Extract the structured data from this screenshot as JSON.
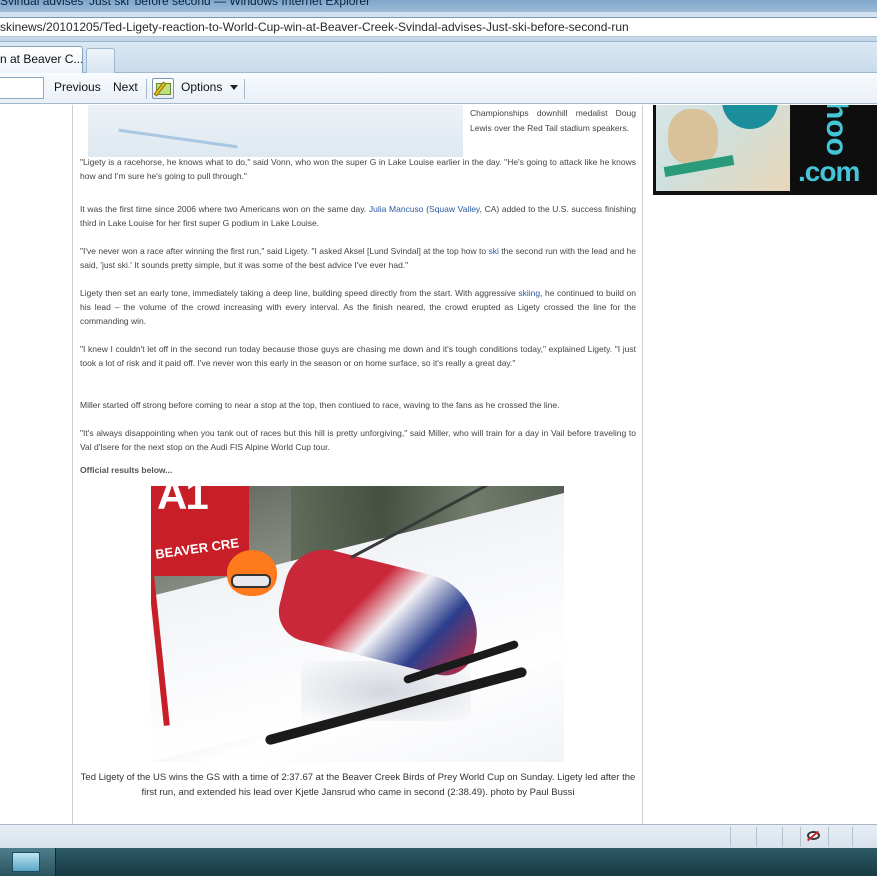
{
  "window": {
    "title": "Svindal advises 'Just ski' before second — Windows Internet Explorer"
  },
  "address": {
    "url": "skinews/20101205/Ted-Ligety-reaction-to-World-Cup-win-at-Beaver-Creek-Svindal-advises-Just-ski-before-second-run"
  },
  "tabs": [
    {
      "label": "n at Beaver C..."
    }
  ],
  "findbar": {
    "search_value": "",
    "previous_label": "Previous",
    "next_label": "Next",
    "options_label": "Options"
  },
  "article": {
    "top_caption": "Championships downhill medalist Doug Lewis over the Red Tail stadium speakers.",
    "p1": "\"Ligety is a racehorse, he knows what to do,\" said Vonn, who won the super G in Lake Louise earlier in the day. \"He's going to attack like he knows how and I'm sure he's going to pull through.\"",
    "p2_a": "It was the first time since 2006 where two Americans won on the same day. ",
    "p2_link1": "Julia Mancuso",
    "p2_b": " (",
    "p2_link2": "Squaw Valley",
    "p2_c": ", CA) added to the U.S. success finishing third in Lake Louise for her first super G podium in Lake Louise.",
    "p3_a": "\"I've never won a race after winning the first run,\" said Ligety. \"I asked Aksel [Lund Svindal] at the top how to ",
    "p3_link": "ski",
    "p3_b": " the second run with the lead and he said, 'just ski.' It sounds pretty simple, but it was some of the best advice I've ever had.\"",
    "p4_a": "Ligety then set an early tone, immediately taking a deep line, building speed directly from the start. With aggressive ",
    "p4_link": "skiing",
    "p4_b": ", he continued to build on his lead – the volume of the crowd increasing with every interval. As the finish neared, the crowd erupted as Ligety crossed the line for the commanding win.",
    "p5": "\"I knew I couldn't let off in the second run today because those guys are chasing me down and it's tough conditions today,\" explained Ligety. \"I just took a lot of risk and it paid off. I've never won this early in the season or on home surface, so it's really a great day.\"",
    "p6": "Miller started off strong before coming to near a stop at the top, then contiued to race, waving to the fans as he crossed the line.",
    "p7": "\"It's always disappointing when you tank out of races but this hill is pretty unforgiving,\" said Miller, who will train for a day in Vail before traveling to Val d'Isere for the next stop on the Audi FIS Alpine World Cup tour.",
    "results_heading": "Official results below...",
    "photo_gate_text": "BEAVER CRE",
    "photo_gate_big": "A1",
    "photo_caption": "Ted Ligety of the US wins the GS with a time of 2:37.67 at the Beaver Creek Birds of Prey World Cup on Sunday. Ligety led after the first run, and extended his lead over Kjetle Jansrud who came in second (2:38.49). photo by Paul Bussi"
  },
  "ad": {
    "brand_text": ".com",
    "brand_vertical": "hoo"
  },
  "colors": {
    "link": "#2a5aa0",
    "gate_red": "#c81e28",
    "helmet_orange": "#ff7a1c",
    "ad_cyan": "#45c6d8"
  },
  "icons": {
    "highlight": "highlight-pencil-icon",
    "options_caret": "chevron-down-icon",
    "privacy": "privacy-eye-icon",
    "taskbar_app": "ie-window-icon"
  }
}
